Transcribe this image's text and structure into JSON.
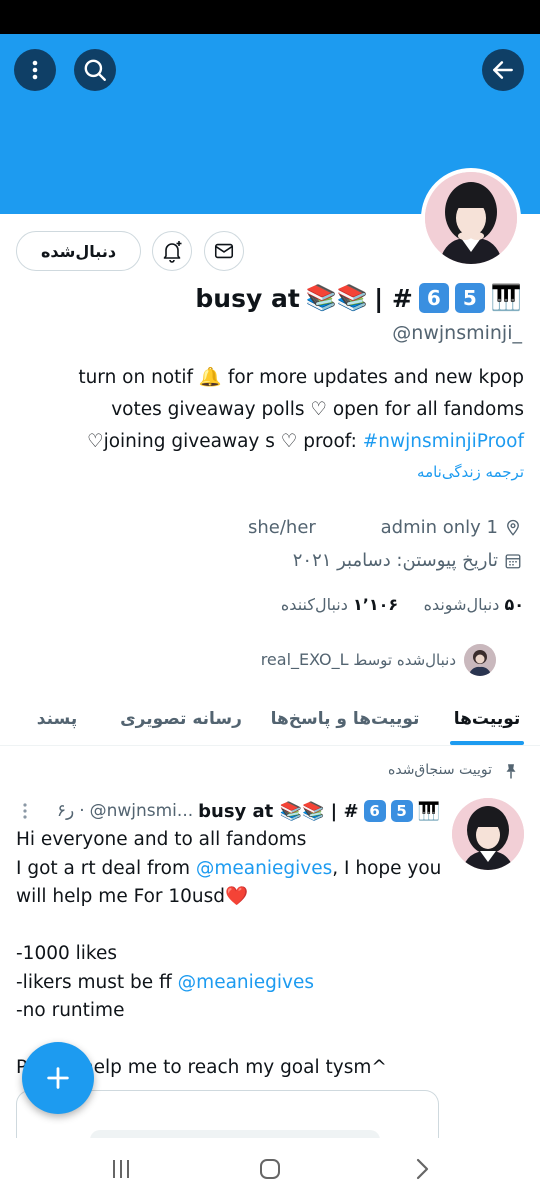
{
  "header": {
    "menu_icon": "more-vertical-icon",
    "search_icon": "search-icon",
    "back_icon": "arrow-forward-icon",
    "banner_color": "#1d9bf0"
  },
  "actions": {
    "following_label": "دنبال‌شده",
    "notify_icon": "bell-plus-icon",
    "message_icon": "envelope-icon"
  },
  "profile": {
    "name_prefix": "busy at",
    "name_emoji": "📚📚",
    "name_sep": "| #",
    "name_key1": "6",
    "name_key2": "5",
    "name_piano": "🎹",
    "handle": "@nwjnsminji_",
    "bio_line1": "turn on notif 🔔 for more updates and new kpop",
    "bio_line2": "votes  giveaway polls ♡ open for all fandoms",
    "bio_line3_prefix": "♡joining giveaway s ♡ proof: ",
    "bio_line3_link": "#nwjnsminjiProof",
    "translate": "ترجمه زندگی‌نامه",
    "location": "1 admin only",
    "pronouns": "she/her",
    "joined": "تاریخ پیوستن: دسامبر ۲۰۲۱",
    "following_count": "۵۰",
    "following_label": "دنبال‌شونده",
    "followers_count": "۱٬۱۰۶",
    "followers_label": "دنبال‌کننده",
    "followed_by_prefix": "دنبال‌شده توسط",
    "followed_by_name": "real_EXO_L"
  },
  "tabs": [
    {
      "label": "توییت‌ها",
      "active": true
    },
    {
      "label": "توییت‌ها و پاسخ‌ها",
      "active": false
    },
    {
      "label": "رسانه تصویری",
      "active": false
    },
    {
      "label": "پسند",
      "active": false
    }
  ],
  "tweet": {
    "pinned_label": "توییت سنجاق‌شده",
    "author_name": "busy at 📚📚 | #",
    "author_handle": "@nwjnsmi...",
    "time": "۶ر",
    "line1": "Hi everyone and to all fandoms",
    "line2_prefix": "I got a rt deal from ",
    "line2_link": "@meaniegives",
    "line2_suffix": ", I hope you",
    "line3": "will help me For 10usd❤️",
    "line4": "-1000 likes",
    "line5_prefix": "-likers must be ff ",
    "line5_link": "@meaniegives",
    "line6": "-no runtime",
    "line7": "Please help me to reach my goal tysm^"
  },
  "fab_icon": "plus-icon",
  "navbar": {
    "recents_icon": "recents-icon",
    "home_icon": "home-icon",
    "back_icon": "back-chevron-icon"
  }
}
